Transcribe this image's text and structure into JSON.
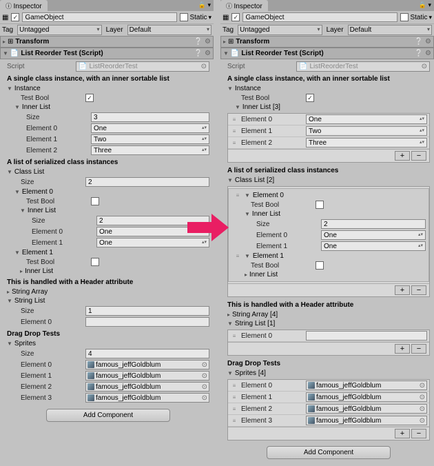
{
  "inspector_tab": "Inspector",
  "gameobject_name": "GameObject",
  "static_label": "Static",
  "tag_label": "Tag",
  "tag_value": "Untagged",
  "layer_label": "Layer",
  "layer_value": "Default",
  "transform_title": "Transform",
  "component_title": "List Reorder Test (Script)",
  "script_label": "Script",
  "script_value": "ListReorderTest",
  "header1": "A single class instance, with an inner sortable list",
  "instance_label": "Instance",
  "testbool_label": "Test Bool",
  "innerlist_label": "Inner List",
  "innerlist_label_n": "Inner List [3]",
  "size_label": "Size",
  "innerlist_size": "3",
  "innerlist_items": [
    "One",
    "Two",
    "Three"
  ],
  "element_labels": [
    "Element 0",
    "Element 1",
    "Element 2",
    "Element 3"
  ],
  "header2": "A list of serialized class instances",
  "classlist_label": "Class List",
  "classlist_label_n": "Class List [2]",
  "classlist_size": "2",
  "classlist_inner_size": "2",
  "classlist_inner_items": [
    "One",
    "One"
  ],
  "header3": "This is handled with a Header attribute",
  "stringarray_label": "String Array",
  "stringarray_label_n": "String Array [4]",
  "stringlist_label": "String List",
  "stringlist_label_n": "String List [1]",
  "stringlist_size": "1",
  "header4": "Drag Drop Tests",
  "sprites_label": "Sprites",
  "sprites_label_n": "Sprites [4]",
  "sprites_size": "4",
  "sprite_name": "famous_jeffGoldblum",
  "add_component": "Add Component"
}
